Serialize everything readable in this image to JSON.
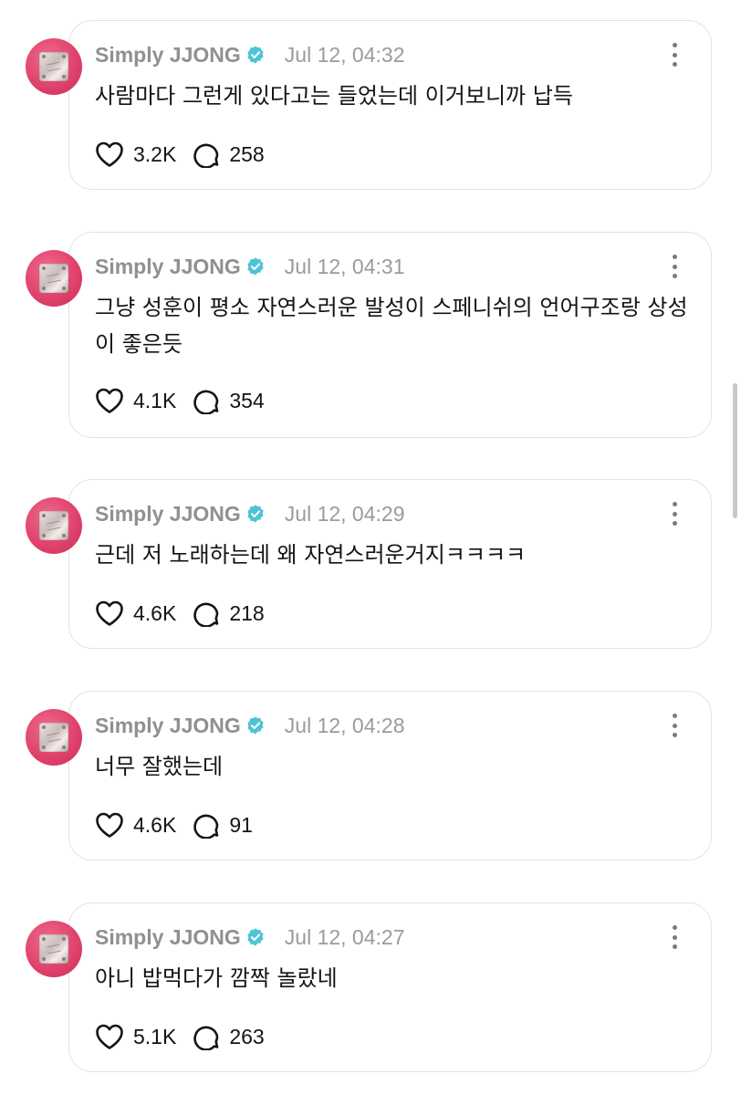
{
  "posts": [
    {
      "author": "Simply JJONG",
      "timestamp": "Jul 12, 04:32",
      "text": "사람마다 그런게 있다고는 들었는데 이거보니까 납득",
      "likes": "3.2K",
      "replies": "258"
    },
    {
      "author": "Simply JJONG",
      "timestamp": "Jul 12, 04:31",
      "text": "그냥 성훈이 평소 자연스러운 발성이 스페니쉬의 언어구조랑 상성이 좋은듯",
      "likes": "4.1K",
      "replies": "354"
    },
    {
      "author": "Simply JJONG",
      "timestamp": "Jul 12, 04:29",
      "text": "근데 저 노래하는데 왜 자연스러운거지ㅋㅋㅋㅋ",
      "likes": "4.6K",
      "replies": "218"
    },
    {
      "author": "Simply JJONG",
      "timestamp": "Jul 12, 04:28",
      "text": "너무 잘했는데",
      "likes": "4.6K",
      "replies": "91"
    },
    {
      "author": "Simply JJONG",
      "timestamp": "Jul 12, 04:27",
      "text": "아니 밥먹다가 깜짝 놀랐네",
      "likes": "5.1K",
      "replies": "263"
    }
  ],
  "colors": {
    "verified_badge": "#4fc3d4",
    "avatar": "#e0436c",
    "card_border": "#e3e3e6",
    "meta_text": "#8f8f94"
  }
}
